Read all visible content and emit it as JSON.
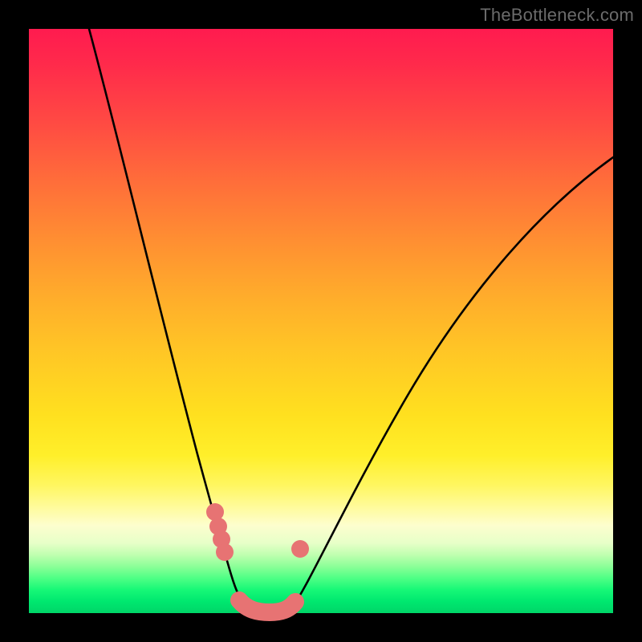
{
  "watermark": "TheBottleneck.com",
  "colors": {
    "background": "#000000",
    "gradient_top": "#ff1b4f",
    "gradient_mid": "#ffe01f",
    "gradient_bottom": "#00d568",
    "curve": "#000000",
    "marker": "#e77373"
  },
  "chart_data": {
    "type": "line",
    "title": "",
    "xlabel": "",
    "ylabel": "",
    "xlim": [
      0,
      100
    ],
    "ylim": [
      0,
      100
    ],
    "grid": false,
    "legend": false,
    "note": "Axes are unlabeled in the source image; values below are estimated from pixel positions on a 0–100 normalized scale where y=0 is bottom (green) and y=100 is top (red).",
    "series": [
      {
        "name": "left-branch",
        "x": [
          10,
          12,
          14,
          16,
          18,
          20,
          22,
          24,
          26,
          28,
          30,
          31,
          32,
          33,
          34,
          35,
          36
        ],
        "y": [
          100,
          92,
          84,
          76,
          68,
          60,
          52,
          44,
          36,
          28,
          20,
          16,
          12,
          9,
          6,
          3.5,
          2
        ]
      },
      {
        "name": "valley-floor",
        "x": [
          36,
          37,
          38,
          39,
          40,
          41,
          42,
          43,
          44
        ],
        "y": [
          2,
          1.3,
          1,
          1,
          1,
          1,
          1,
          1.3,
          2
        ]
      },
      {
        "name": "right-branch",
        "x": [
          44,
          46,
          50,
          55,
          60,
          65,
          70,
          75,
          80,
          85,
          90,
          95,
          100
        ],
        "y": [
          2,
          6,
          14,
          24,
          33,
          42,
          50,
          57,
          63,
          68,
          72,
          76,
          79
        ]
      }
    ],
    "markers": {
      "name": "highlighted-points",
      "comment": "Pink rounded markers clustered near the valley minimum.",
      "points": [
        {
          "x": 31.5,
          "y": 17
        },
        {
          "x": 32,
          "y": 14.5
        },
        {
          "x": 32.5,
          "y": 12.5
        },
        {
          "x": 33,
          "y": 10.5
        },
        {
          "x": 46,
          "y": 10.5
        },
        {
          "x": 35,
          "y": 2,
          "role": "floor-cap-left"
        },
        {
          "x": 44.5,
          "y": 2,
          "role": "floor-cap-right"
        }
      ]
    }
  }
}
